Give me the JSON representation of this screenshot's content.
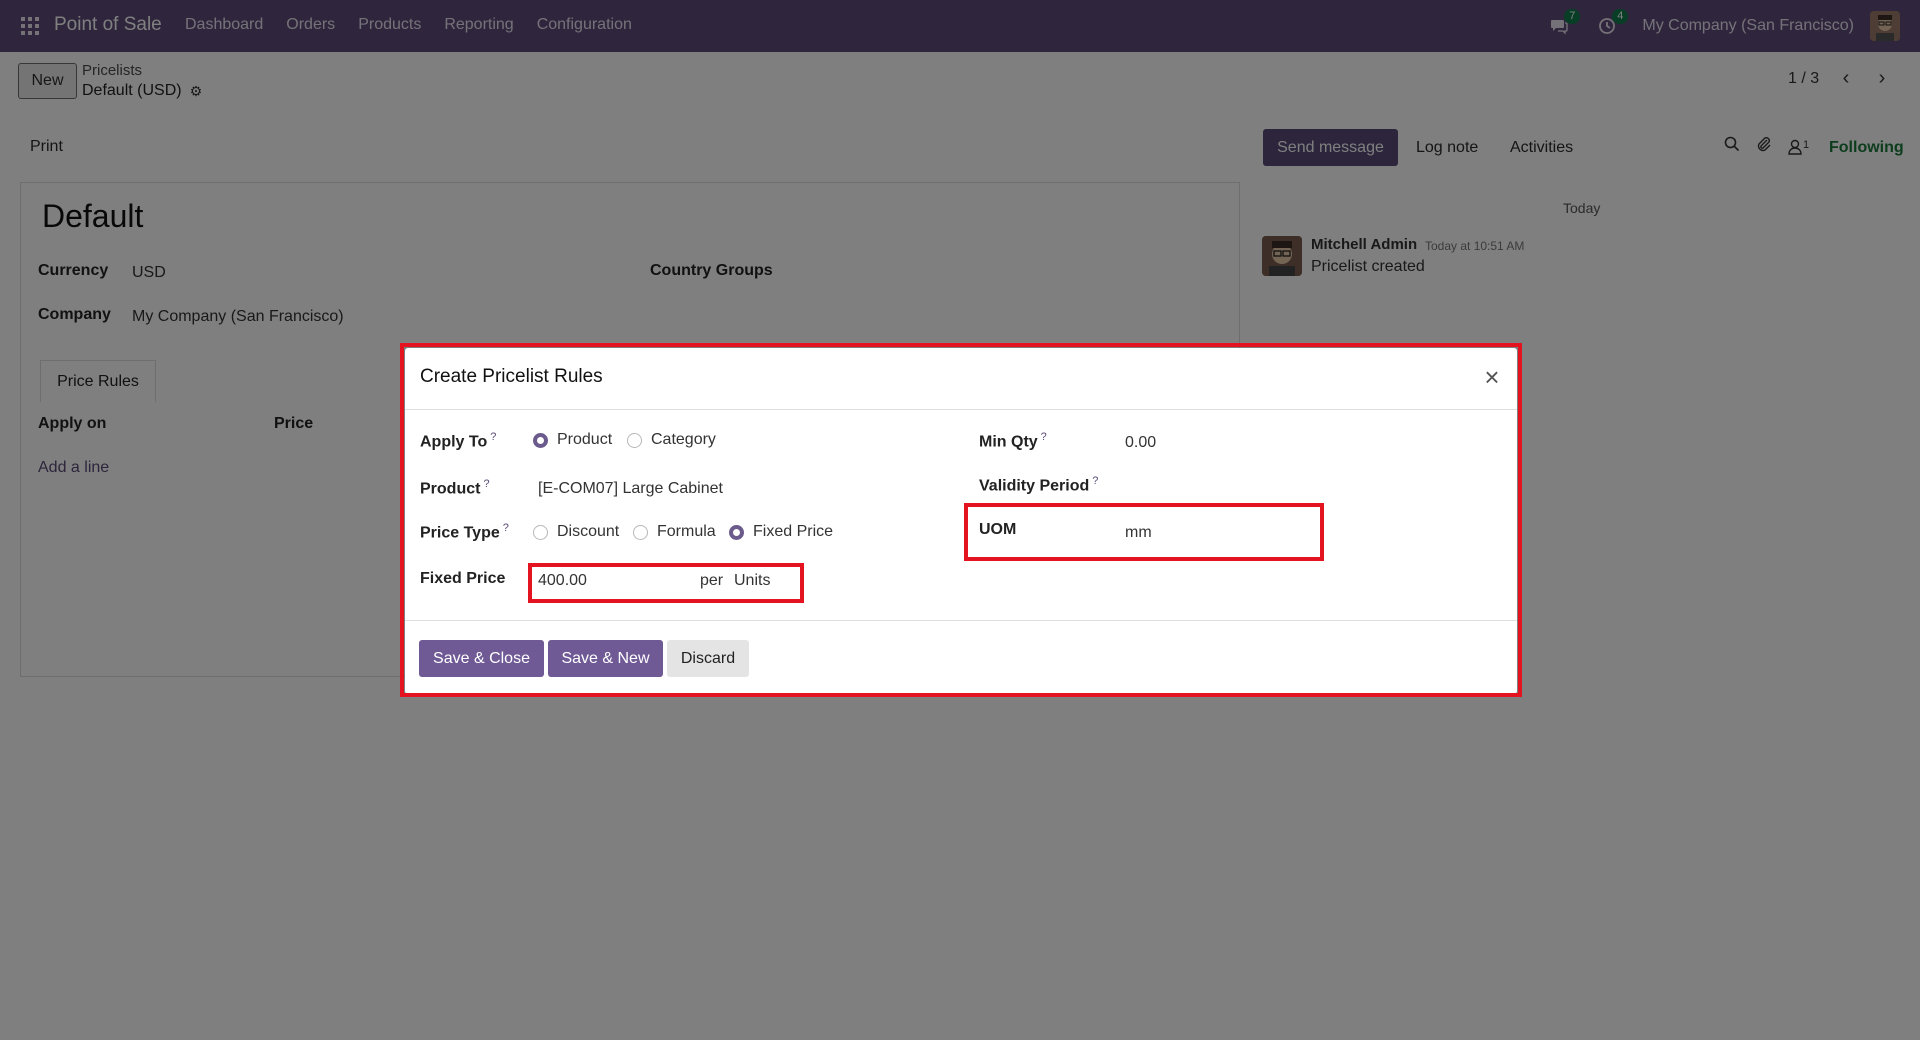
{
  "navbar": {
    "app_name": "Point of Sale",
    "menu": [
      "Dashboard",
      "Orders",
      "Products",
      "Reporting",
      "Configuration"
    ],
    "messages_count": "7",
    "activities_count": "4",
    "company": "My Company (San Francisco)"
  },
  "control_panel": {
    "new_label": "New",
    "breadcrumb_parent": "Pricelists",
    "breadcrumb_current": "Default (USD)",
    "pager": "1 / 3"
  },
  "actions": {
    "print": "Print",
    "send_message": "Send message",
    "log_note": "Log note",
    "activities": "Activities",
    "followers_count": "1",
    "following": "Following"
  },
  "form": {
    "title": "Default",
    "currency_label": "Currency",
    "currency_value": "USD",
    "company_label": "Company",
    "company_value": "My Company (San Francisco)",
    "country_groups_label": "Country Groups",
    "tab_price_rules": "Price Rules",
    "col_apply_on": "Apply on",
    "col_price": "Price",
    "add_line": "Add a line"
  },
  "chatter": {
    "date_separator": "Today",
    "author": "Mitchell Admin",
    "time": "Today at 10:51 AM",
    "body": "Pricelist created"
  },
  "modal": {
    "title": "Create Pricelist Rules",
    "apply_to_label": "Apply To",
    "apply_to_options": [
      "Product",
      "Category"
    ],
    "apply_to_selected": "Product",
    "product_label": "Product",
    "product_value": "[E-COM07] Large Cabinet",
    "price_type_label": "Price Type",
    "price_type_options": [
      "Discount",
      "Formula",
      "Fixed Price"
    ],
    "price_type_selected": "Fixed Price",
    "fixed_price_label": "Fixed Price",
    "fixed_price_value": "400.00",
    "per_label": "per",
    "per_unit": "Units",
    "min_qty_label": "Min Qty",
    "min_qty_value": "0.00",
    "validity_label": "Validity Period",
    "uom_label": "UOM",
    "uom_value": "mm",
    "help_mark": "?",
    "save_close": "Save & Close",
    "save_new": "Save & New",
    "discard": "Discard"
  },
  "colors": {
    "navbar": "#5e4d7a",
    "primary": "#6f5a96",
    "highlight": "#e3141f",
    "following": "#1b7a3b"
  }
}
